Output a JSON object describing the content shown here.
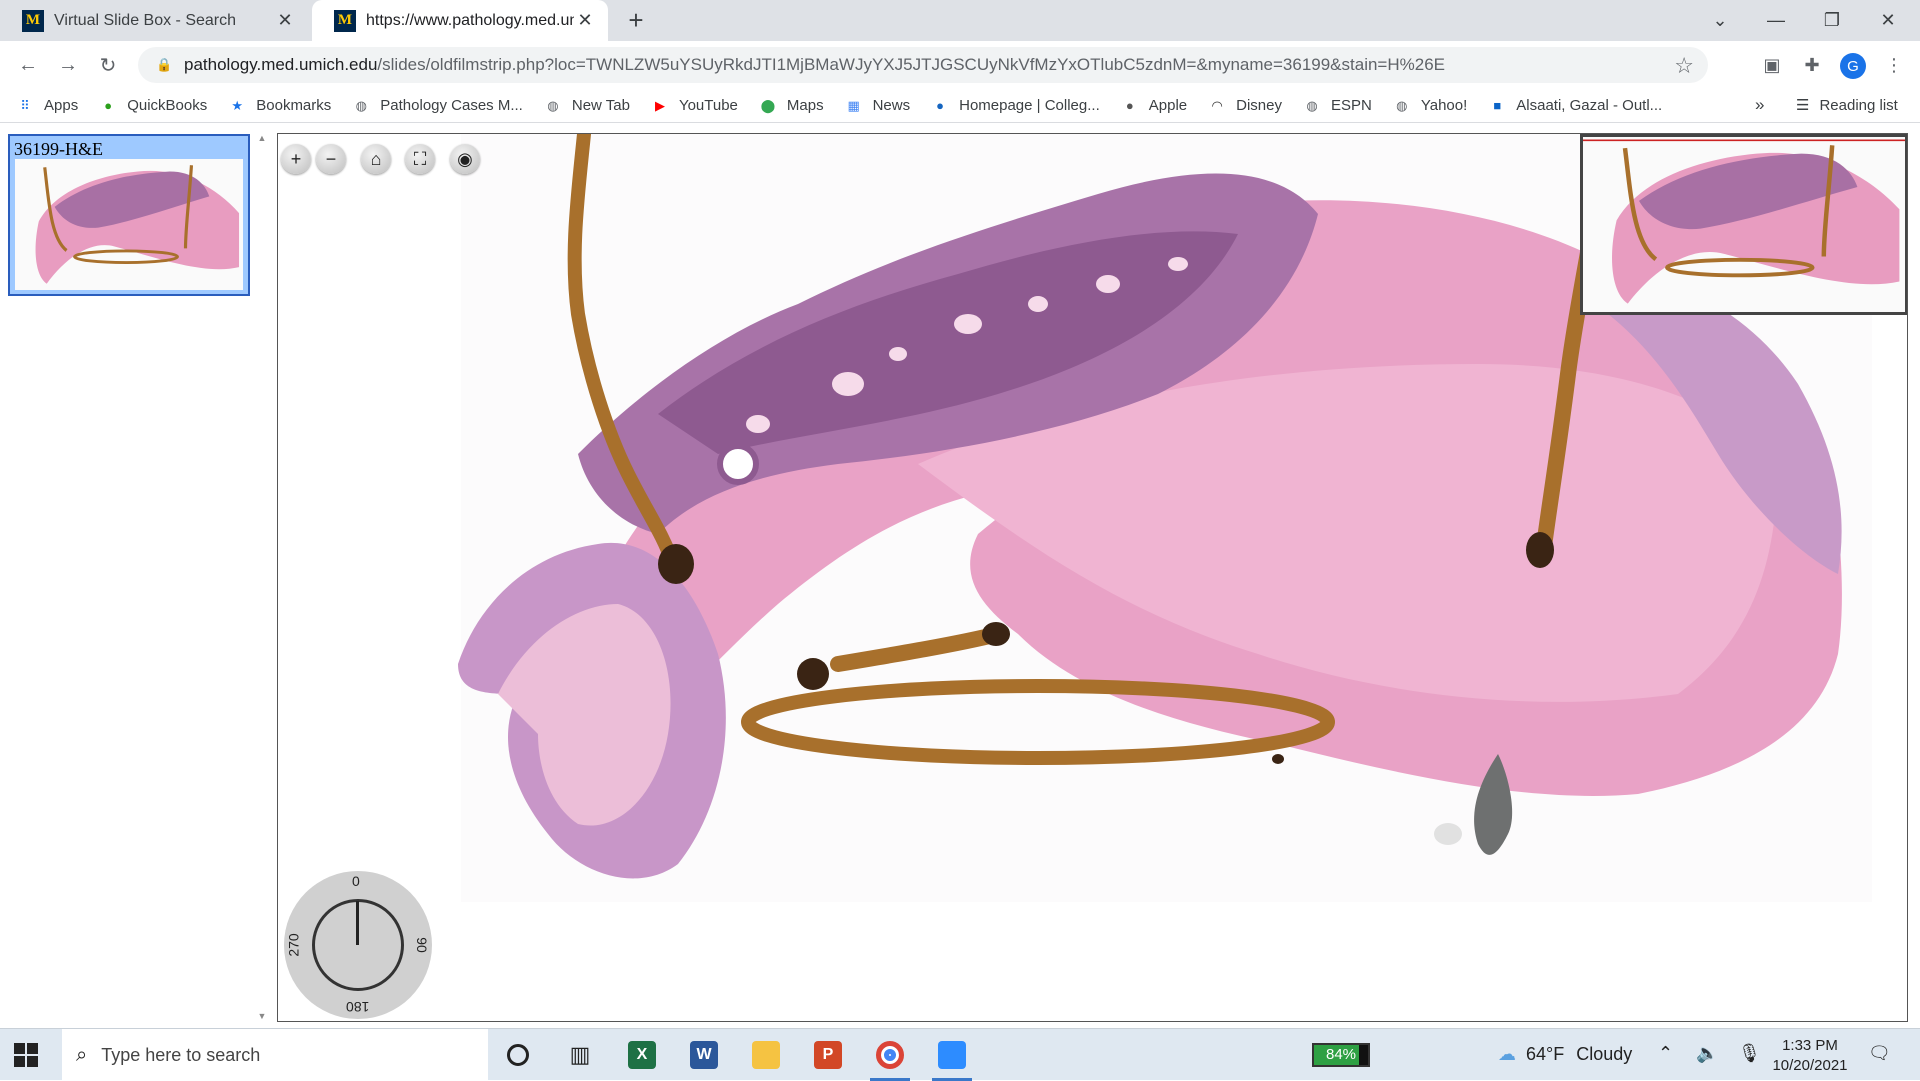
{
  "browser": {
    "tabs": [
      {
        "title": "Virtual Slide Box - Search",
        "favicon": "M",
        "active": false
      },
      {
        "title": "https://www.pathology.med.umich",
        "favicon": "M",
        "active": true
      }
    ],
    "url_host": "pathology.med.umich.edu",
    "url_path": "/slides/oldfilmstrip.php?loc=TWNLZW5uYSUyRkdJTI1MjBMaWJyYXJ5JTJGSCUyNkVfMzYxOTlubC5zdnM=&myname=36199&stain=H%26E",
    "profile_initial": "G",
    "bookmarks": [
      {
        "label": "Apps",
        "icon": "apps-grid-icon",
        "color": "#1a73e8"
      },
      {
        "label": "QuickBooks",
        "icon": "quickbooks-icon",
        "color": "#2ca01c"
      },
      {
        "label": "Bookmarks",
        "icon": "star-icon",
        "color": "#1a73e8"
      },
      {
        "label": "Pathology Cases M...",
        "icon": "globe-icon",
        "color": "#5f6368"
      },
      {
        "label": "New Tab",
        "icon": "globe-icon",
        "color": "#5f6368"
      },
      {
        "label": "YouTube",
        "icon": "youtube-icon",
        "color": "#ff0000"
      },
      {
        "label": "Maps",
        "icon": "maps-pin-icon",
        "color": "#34a853"
      },
      {
        "label": "News",
        "icon": "news-icon",
        "color": "#4285f4"
      },
      {
        "label": "Homepage | Colleg...",
        "icon": "cap-icon",
        "color": "#1565c0"
      },
      {
        "label": "Apple",
        "icon": "apple-icon",
        "color": "#555555"
      },
      {
        "label": "Disney",
        "icon": "disney-icon",
        "color": "#333333"
      },
      {
        "label": "ESPN",
        "icon": "globe-icon",
        "color": "#5f6368"
      },
      {
        "label": "Yahoo!",
        "icon": "globe-icon",
        "color": "#5f6368"
      },
      {
        "label": "Alsaati, Gazal - Outl...",
        "icon": "outlook-icon",
        "color": "#0a64c8"
      }
    ],
    "bookmarks_more": "»",
    "reading_list": "Reading list"
  },
  "slide_viewer": {
    "thumbnail_label": "36199-H&E",
    "rotation": {
      "top": "0",
      "right": "90",
      "bottom": "180",
      "left": "270",
      "angle_deg": 0
    },
    "colors": {
      "stroma": "#e89cc0",
      "mucosa": "#a870a4",
      "suture": "#a8702c",
      "background": "#fefefe"
    }
  },
  "taskbar": {
    "search_placeholder": "Type here to search",
    "apps": [
      {
        "name": "cortana-icon",
        "label": "O"
      },
      {
        "name": "task-view-icon",
        "label": ""
      },
      {
        "name": "excel-icon",
        "label": "X"
      },
      {
        "name": "word-icon",
        "label": "W"
      },
      {
        "name": "file-explorer-icon",
        "label": ""
      },
      {
        "name": "powerpoint-icon",
        "label": "P"
      },
      {
        "name": "chrome-icon",
        "label": ""
      },
      {
        "name": "zoom-icon",
        "label": ""
      }
    ],
    "battery_text": "84%",
    "battery_level": 0.84,
    "weather_temp": "64°F",
    "weather_desc": "Cloudy",
    "time": "1:33 PM",
    "date": "10/20/2021"
  }
}
